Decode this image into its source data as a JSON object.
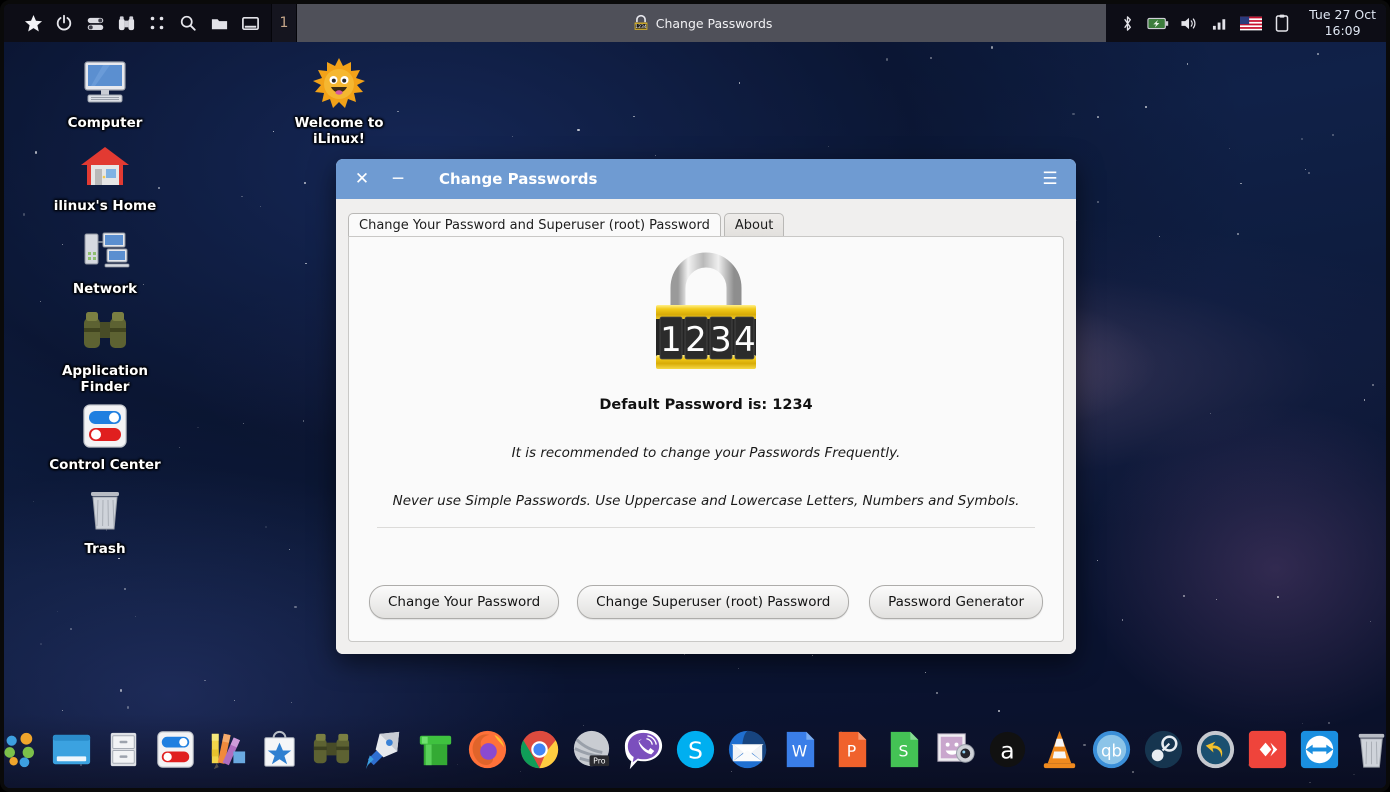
{
  "taskbar": {
    "launchers": [
      {
        "name": "applications-menu-star",
        "icon": "star-icon"
      },
      {
        "name": "power-button",
        "icon": "power-icon"
      },
      {
        "name": "settings-toggles",
        "icon": "toggles-icon"
      },
      {
        "name": "application-finder",
        "icon": "binoculars-icon"
      },
      {
        "name": "show-all-windows",
        "icon": "grid-dots-icon"
      },
      {
        "name": "search",
        "icon": "search-icon"
      },
      {
        "name": "file-manager",
        "icon": "folder-icon"
      },
      {
        "name": "show-desktop",
        "icon": "window-icon"
      }
    ],
    "workspace": "1",
    "active_task": "Change Passwords",
    "tray": [
      {
        "name": "bluetooth",
        "icon": "bluetooth-icon"
      },
      {
        "name": "battery",
        "icon": "battery-icon"
      },
      {
        "name": "volume",
        "icon": "speaker-icon"
      },
      {
        "name": "network-signal",
        "icon": "signal-bars-icon"
      },
      {
        "name": "keyboard-layout",
        "icon": "us-flag-icon"
      },
      {
        "name": "clipboard-manager",
        "icon": "clipboard-icon"
      }
    ],
    "clock_date": "Tue 27 Oct",
    "clock_time": "16:09"
  },
  "desktop_icons": [
    {
      "label": "Computer",
      "icon": "computer-icon"
    },
    {
      "label": "ilinux's Home",
      "icon": "home-icon"
    },
    {
      "label": "Network",
      "icon": "network-icon"
    },
    {
      "label": "Application Finder",
      "icon": "binoculars-icon"
    },
    {
      "label": "Control Center",
      "icon": "control-center-icon"
    },
    {
      "label": "Trash",
      "icon": "trash-icon"
    },
    {
      "label": "Welcome to iLinux!",
      "icon": "sun-smile-icon"
    }
  ],
  "dialog": {
    "title": "Change Passwords",
    "close_label": "✕",
    "minimize_label": "─",
    "menu_label": "☰",
    "tabs": [
      {
        "label": "Change Your Password and Superuser (root) Password",
        "active": true
      },
      {
        "label": "About",
        "active": false
      }
    ],
    "lock_digits": [
      "1",
      "2",
      "3",
      "4"
    ],
    "headline": "Default Password is: 1234",
    "note1": "It is recommended to change your Passwords Frequently.",
    "note2": "Never use Simple Passwords. Use Uppercase and Lowercase Letters, Numbers and Symbols.",
    "buttons": [
      {
        "label": "Change Your Password",
        "name": "change-your-password-button"
      },
      {
        "label": "Change Superuser (root) Password",
        "name": "change-superuser-password-button"
      },
      {
        "label": "Password Generator",
        "name": "password-generator-button"
      }
    ],
    "titlebar_color": "#6f9bd2"
  },
  "dock": [
    {
      "name": "star-menu",
      "icon": "yellow-star-icon"
    },
    {
      "name": "app-grid",
      "icon": "colored-dots-icon"
    },
    {
      "name": "file-manager",
      "icon": "blue-window-icon"
    },
    {
      "name": "archive-manager",
      "icon": "file-cabinet-icon"
    },
    {
      "name": "control-center",
      "icon": "toggles-icon"
    },
    {
      "name": "color-picker",
      "icon": "palette-icon"
    },
    {
      "name": "software-store",
      "icon": "shopping-bag-star-icon"
    },
    {
      "name": "application-finder",
      "icon": "binoculars-icon"
    },
    {
      "name": "rocket-launcher",
      "icon": "rocket-icon"
    },
    {
      "name": "pipe-app",
      "icon": "green-pipe-icon"
    },
    {
      "name": "firefox",
      "icon": "firefox-icon"
    },
    {
      "name": "google-chrome",
      "icon": "chrome-icon"
    },
    {
      "name": "opera-gx-pro",
      "icon": "pro-sphere-icon"
    },
    {
      "name": "viber",
      "icon": "viber-icon"
    },
    {
      "name": "skype",
      "icon": "skype-icon"
    },
    {
      "name": "thunderbird-mail",
      "icon": "mail-icon"
    },
    {
      "name": "wps-writer",
      "icon": "w-document-icon"
    },
    {
      "name": "wps-presentation",
      "icon": "p-document-icon"
    },
    {
      "name": "wps-spreadsheet",
      "icon": "s-document-icon"
    },
    {
      "name": "image-viewer",
      "icon": "photo-webcam-icon"
    },
    {
      "name": "audacious",
      "icon": "letter-a-circle-icon"
    },
    {
      "name": "vlc-media-player",
      "icon": "traffic-cone-icon"
    },
    {
      "name": "qbittorrent",
      "icon": "qb-circle-icon"
    },
    {
      "name": "steam",
      "icon": "steam-icon"
    },
    {
      "name": "backup-restore",
      "icon": "undo-arrow-icon"
    },
    {
      "name": "anydesk",
      "icon": "anydesk-icon"
    },
    {
      "name": "teamviewer",
      "icon": "teamviewer-icon"
    },
    {
      "name": "trash",
      "icon": "trash-icon"
    },
    {
      "name": "change-passwords",
      "icon": "padlock-1234-icon"
    }
  ]
}
